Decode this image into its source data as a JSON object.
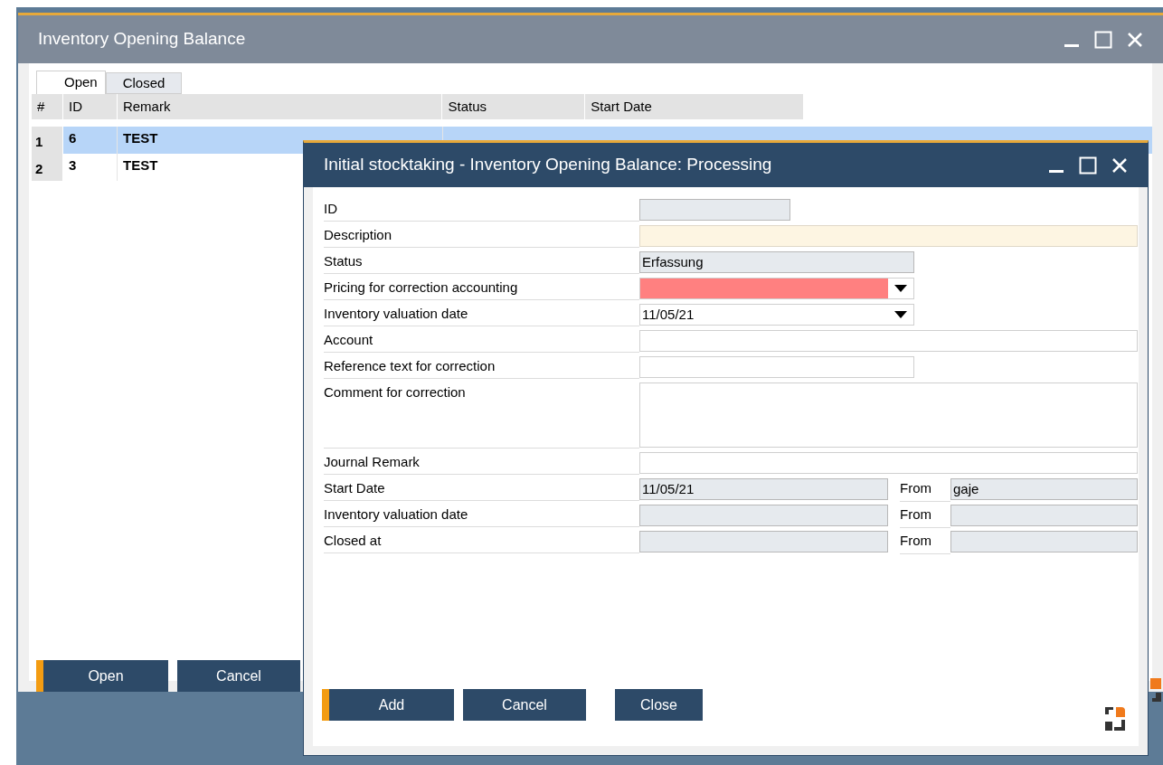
{
  "main_window": {
    "title": "Inventory Opening Balance",
    "tabs": [
      {
        "label": "Open",
        "selected": true
      },
      {
        "label": "Closed",
        "selected": false
      }
    ],
    "table": {
      "columns": [
        "#",
        "ID",
        "Remark",
        "Status",
        "Start Date"
      ],
      "rows": [
        {
          "cells": [
            "1",
            "6",
            "TEST"
          ],
          "selected": true
        },
        {
          "cells": [
            "2",
            "3",
            "TEST"
          ],
          "selected": false
        }
      ]
    },
    "buttons": [
      {
        "label": "Open",
        "primary": true
      },
      {
        "label": "Cancel",
        "primary": false
      }
    ]
  },
  "dialog": {
    "title": "Initial stocktaking - Inventory Opening Balance: Processing",
    "fields": [
      {
        "label": "ID",
        "kind": "id",
        "read_only": true,
        "focused": false,
        "invalid": false
      },
      {
        "label": "Description",
        "kind": "text",
        "read_only": false,
        "focused": true,
        "invalid": false
      },
      {
        "label": "Status",
        "kind": "line",
        "read_only": true,
        "focused": false,
        "invalid": false,
        "value": "Erfassung"
      },
      {
        "label": "Pricing for correction accounting",
        "kind": "dropdown",
        "read_only": false,
        "focused": false,
        "invalid": true
      },
      {
        "label": "Inventory valuation date",
        "kind": "dropdown",
        "read_only": false,
        "focused": false,
        "invalid": false,
        "value": "11/05/21"
      },
      {
        "label": "Account",
        "kind": "text",
        "read_only": false,
        "focused": false,
        "invalid": false
      },
      {
        "label": "Reference text for correction",
        "kind": "line",
        "read_only": false,
        "focused": false,
        "invalid": false
      },
      {
        "label": "Comment for correction",
        "kind": "memo",
        "read_only": false,
        "focused": false,
        "invalid": false
      },
      {
        "label": "Journal Remark",
        "kind": "text",
        "read_only": false,
        "focused": false,
        "invalid": false
      },
      {
        "label": "Start Date",
        "kind": "stamp",
        "read_only": true,
        "focused": false,
        "invalid": false,
        "value": "11/05/21",
        "from_label": "From",
        "from_value": "gaje"
      },
      {
        "label": "Inventory valuation date",
        "kind": "stamp",
        "read_only": true,
        "focused": false,
        "invalid": false,
        "from_label": "From"
      },
      {
        "label": "Closed at",
        "kind": "stamp",
        "read_only": true,
        "focused": false,
        "invalid": false,
        "from_label": "From"
      }
    ],
    "buttons": [
      {
        "label": "Add",
        "primary": true
      },
      {
        "label": "Cancel",
        "primary": false
      },
      {
        "label": "Close",
        "primary": false
      }
    ]
  }
}
